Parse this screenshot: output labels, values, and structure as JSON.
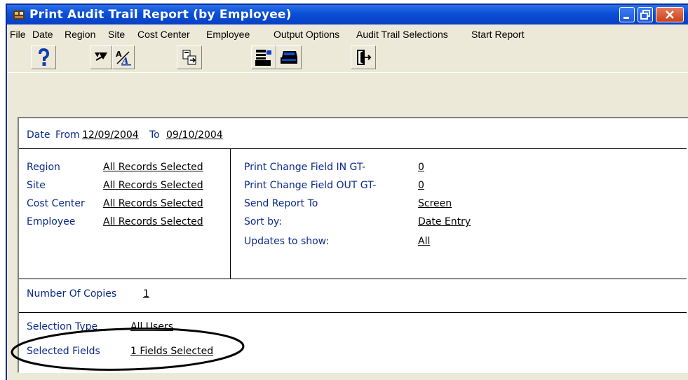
{
  "window": {
    "title": "Print Audit Trail Report (by Employee)",
    "icons": [
      "app-icon",
      "minimize-icon",
      "restore-icon",
      "close-icon"
    ]
  },
  "menu": {
    "items": [
      "File",
      "Date",
      "Region",
      "Site",
      "Cost Center",
      "Employee",
      "Output Options",
      "Audit Trail Selections",
      "Start Report"
    ]
  },
  "toolbar": {
    "icons": [
      "help-icon",
      "filter-icon",
      "font-icon",
      "export-icon",
      "printer-setup-icon",
      "printer-icon",
      "exit-icon"
    ]
  },
  "date_row": {
    "label": "Date",
    "from_label": "From",
    "from_value": "12/09/2004",
    "to_label": "To",
    "to_value": "09/10/2004"
  },
  "left_fields": [
    {
      "label": "Region",
      "value": "All Records Selected"
    },
    {
      "label": "Site",
      "value": "All Records Selected"
    },
    {
      "label": "Cost Center",
      "value": "All Records Selected"
    },
    {
      "label": "Employee",
      "value": "All Records Selected"
    }
  ],
  "right_fields": [
    {
      "label": "Print Change Field IN GT-",
      "value": "0"
    },
    {
      "label": "Print Change Field OUT GT-",
      "value": "0"
    },
    {
      "label": "Send Report To",
      "value": "Screen"
    },
    {
      "label": "Sort by:",
      "value": "Date Entry"
    },
    {
      "label": "Updates to show:",
      "value": "All"
    }
  ],
  "copies": {
    "label": "Number Of Copies",
    "value": "1"
  },
  "selection": {
    "type_label": "Selection Type",
    "type_value": "All Users",
    "fields_label": "Selected Fields",
    "fields_value": "1 Fields Selected"
  }
}
